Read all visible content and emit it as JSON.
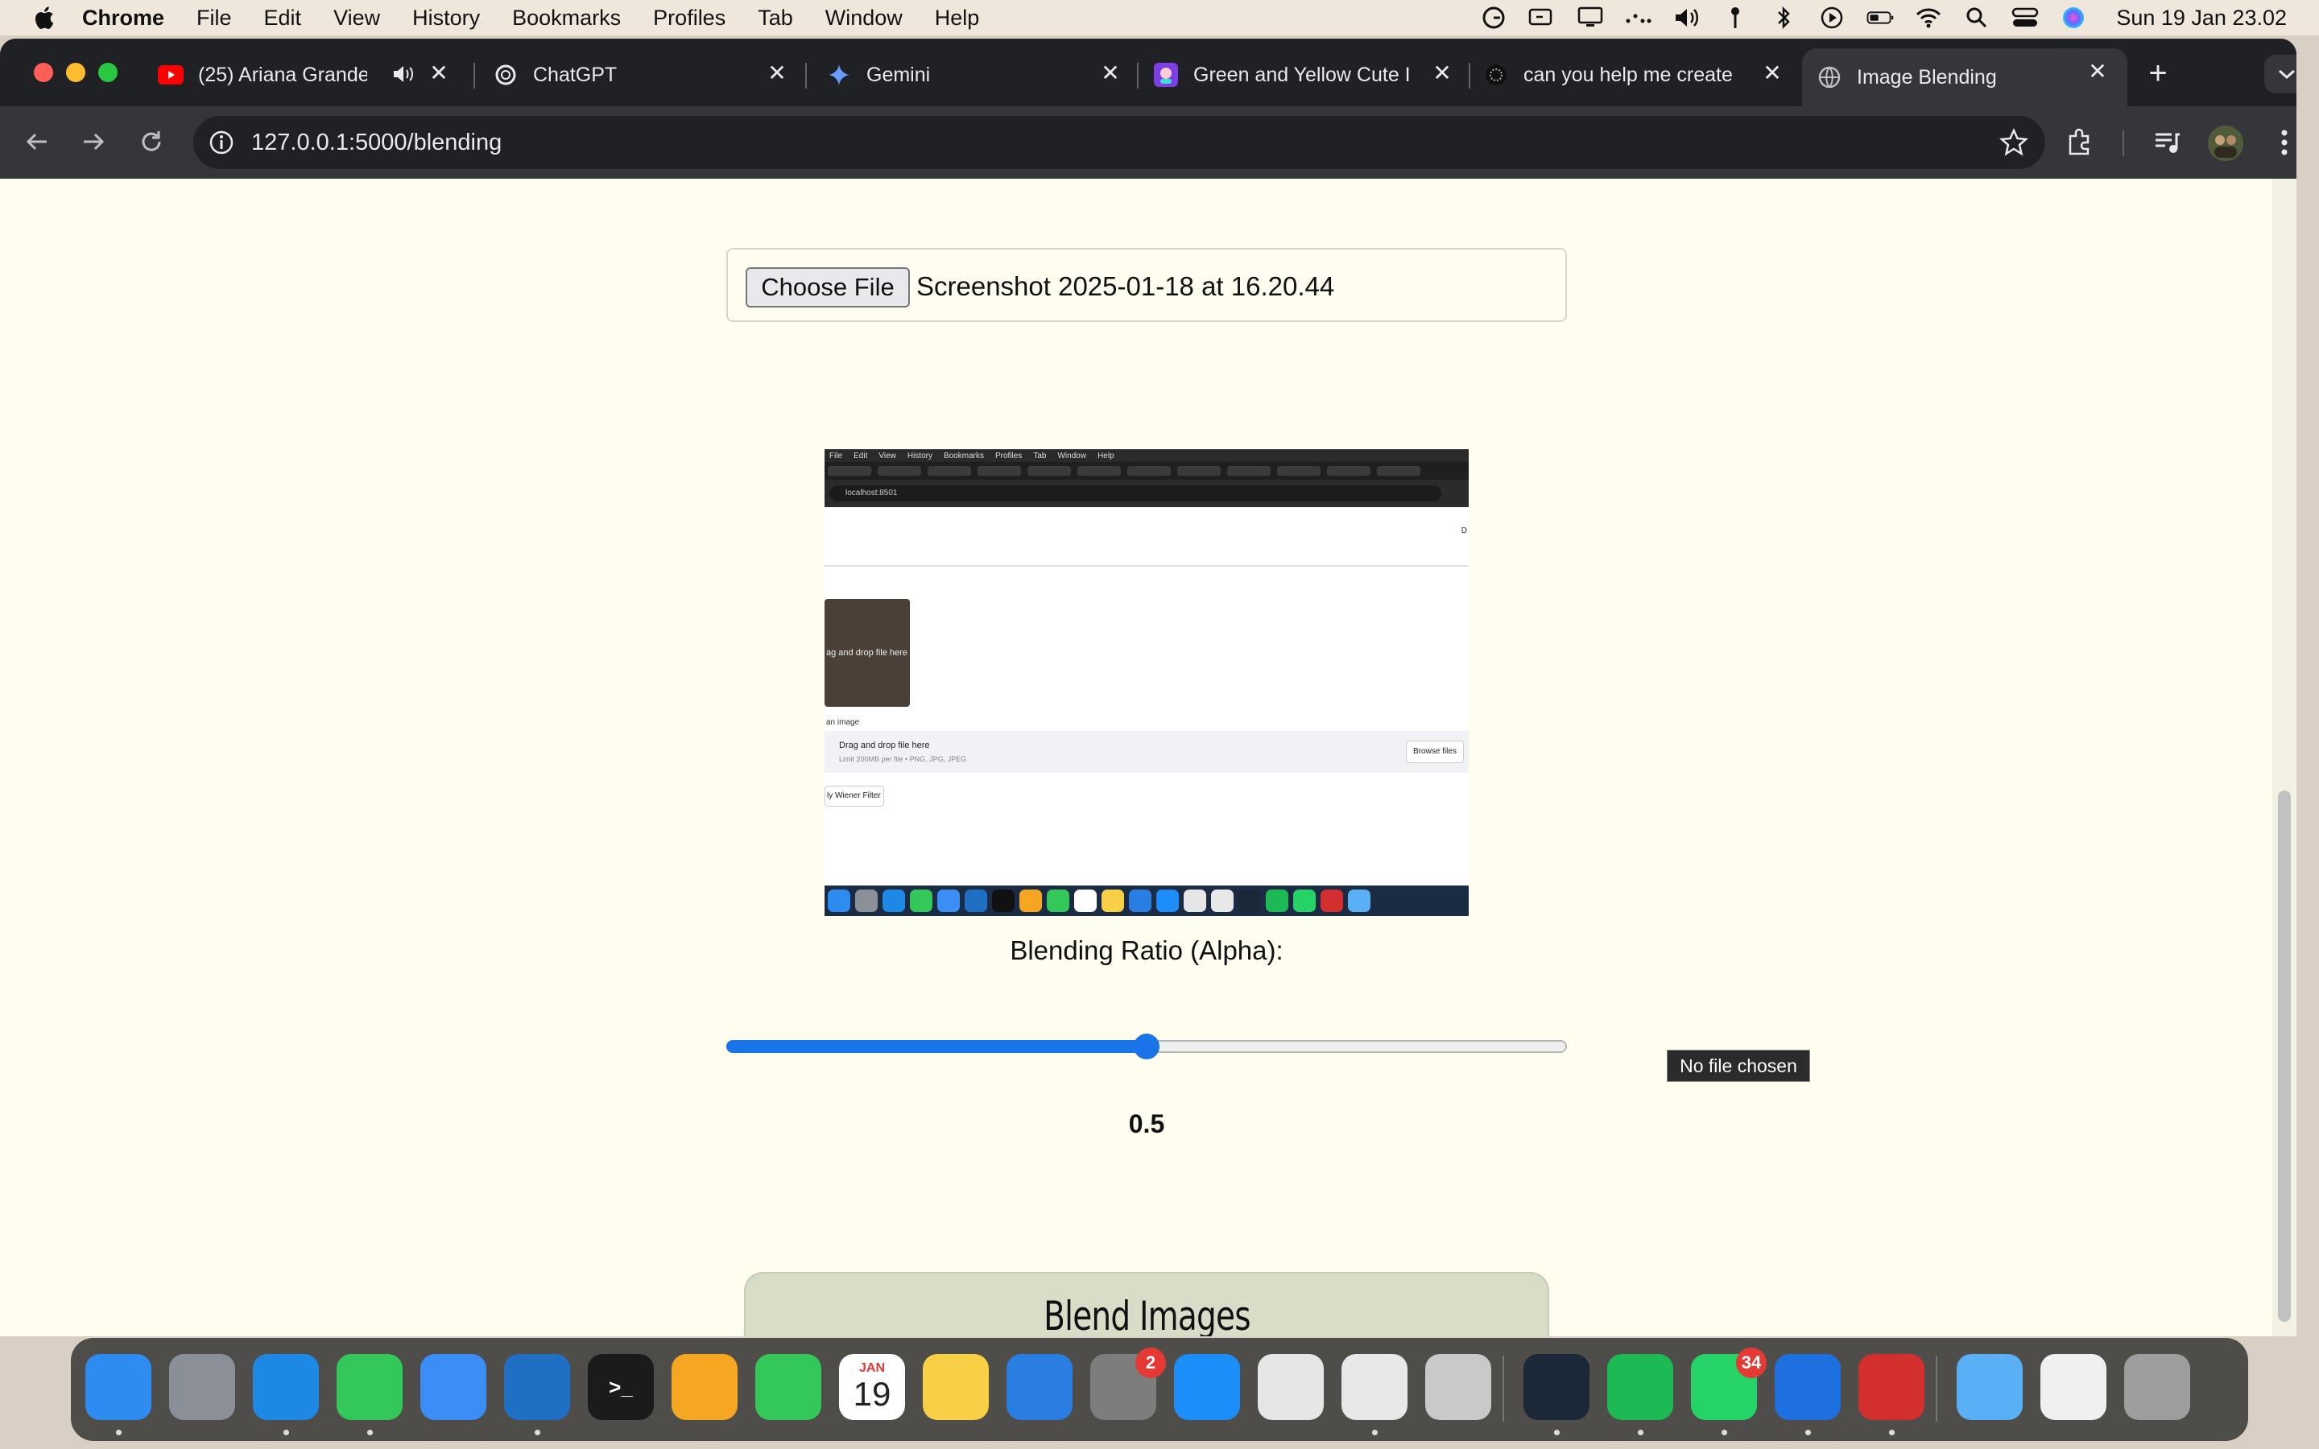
{
  "menubar": {
    "app_name": "Chrome",
    "items": [
      "File",
      "Edit",
      "View",
      "History",
      "Bookmarks",
      "Profiles",
      "Tab",
      "Window",
      "Help"
    ],
    "clock": "Sun 19 Jan  23.02",
    "status_icons": [
      "grammarly-icon",
      "screen-mirroring-icon",
      "display-icon",
      "dots-icon",
      "volume-icon",
      "pin-icon",
      "bluetooth-icon",
      "play-icon",
      "battery-icon",
      "wifi-icon",
      "spotlight-icon",
      "control-center-icon",
      "siri-icon"
    ]
  },
  "tabs": [
    {
      "title": "(25) Ariana Grande -",
      "icon": "youtube-icon",
      "audio": true
    },
    {
      "title": "ChatGPT",
      "icon": "chatgpt-icon"
    },
    {
      "title": "Gemini",
      "icon": "gemini-icon"
    },
    {
      "title": "Green and Yellow Cute I",
      "icon": "canva-icon"
    },
    {
      "title": "can you help me create",
      "icon": "perplexity-icon"
    },
    {
      "title": "Image Blending",
      "icon": "globe-icon",
      "active": true
    }
  ],
  "address_bar": {
    "url": "127.0.0.1:5000/blending"
  },
  "page": {
    "file_input": {
      "button_label": "Choose File",
      "file_name": "Screenshot 2025-01-18 at 16.20.44"
    },
    "preview": {
      "menu": [
        "File",
        "Edit",
        "View",
        "History",
        "Bookmarks",
        "Profiles",
        "Tab",
        "Window",
        "Help"
      ],
      "url": "localhost:8501",
      "drop_label": "ag and drop file here",
      "upload_label": "an image",
      "drag_text": "Drag and drop file here",
      "limit_text": "Limit 200MB per file • PNG, JPG, JPEG",
      "browse_label": "Browse files",
      "apply_label": "ly Wiener Filter",
      "corner": "D"
    },
    "alpha_label": "Blending Ratio (Alpha):",
    "alpha_value": "0.5",
    "alpha_fraction": 0.5,
    "tooltip": "No file chosen",
    "blend_button": "Blend Images"
  },
  "dock": {
    "apps": [
      {
        "name": "finder-icon",
        "color": "#2d8cf0"
      },
      {
        "name": "launchpad-icon",
        "color": "#8a8f98"
      },
      {
        "name": "safari-icon",
        "color": "#1e88e5"
      },
      {
        "name": "messages-icon",
        "color": "#34c759"
      },
      {
        "name": "mail-icon",
        "color": "#3a8ef6"
      },
      {
        "name": "vscode-icon",
        "color": "#1f6fc5"
      },
      {
        "name": "terminal-icon",
        "color": "#1b1b1b"
      },
      {
        "name": "photos-icon",
        "color": "#f5a623"
      },
      {
        "name": "facetime-icon",
        "color": "#34c759"
      },
      {
        "name": "calendar-icon",
        "color": "#ffffff"
      },
      {
        "name": "notes-icon",
        "color": "#f7d046"
      },
      {
        "name": "keynote-icon",
        "color": "#2a7de1"
      },
      {
        "name": "system-settings-icon",
        "color": "#7d7d7d"
      },
      {
        "name": "app-store-icon",
        "color": "#1c8ef9"
      },
      {
        "name": "roblox-icon",
        "color": "#e6e6e6"
      },
      {
        "name": "chrome-icon",
        "color": "#e8e8e8"
      },
      {
        "name": "iphone-mirroring-icon",
        "color": "#c9c9c9"
      },
      {
        "name": "steam-icon",
        "color": "#1b2838"
      },
      {
        "name": "spotify-icon",
        "color": "#1db954"
      },
      {
        "name": "whatsapp-icon",
        "color": "#25d366"
      },
      {
        "name": "xcode-icon",
        "color": "#1e6fe0"
      },
      {
        "name": "photo-booth-icon",
        "color": "#d32f2f"
      },
      {
        "name": "folder-icon",
        "color": "#5ab0f5"
      },
      {
        "name": "screenshot-preview-icon",
        "color": "#f0f0f0"
      },
      {
        "name": "trash-icon",
        "color": "#9e9e9e"
      }
    ],
    "calendar": {
      "month": "JAN",
      "day": "19"
    },
    "badges": {
      "settings": "2",
      "whatsapp": "34"
    }
  }
}
